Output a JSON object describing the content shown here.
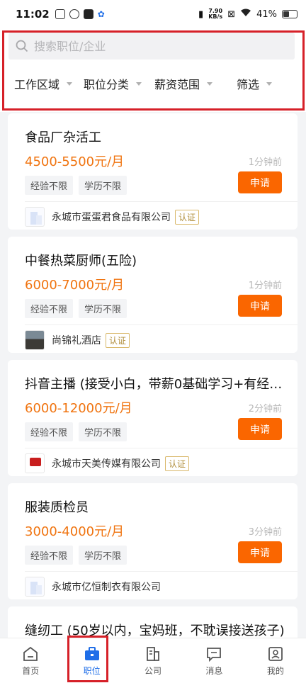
{
  "status_bar": {
    "time": "11:02",
    "net_speed_value": "7.90",
    "net_speed_unit": "KB/s",
    "battery": "41%"
  },
  "search": {
    "placeholder": "搜索职位/企业"
  },
  "filters": [
    {
      "label": "工作区域"
    },
    {
      "label": "职位分类"
    },
    {
      "label": "薪资范围"
    },
    {
      "label": "筛选"
    }
  ],
  "jobs": [
    {
      "title": "食品厂杂活工",
      "salary": "4500-5500元/月",
      "time": "1分钟前",
      "tags": [
        "经验不限",
        "学历不限"
      ],
      "apply": "申请",
      "company": "永城市蛋蛋君食品有限公司",
      "verified": "认证"
    },
    {
      "title": "中餐热菜厨师(五险)",
      "salary": "6000-7000元/月",
      "time": "1分钟前",
      "tags": [
        "经验不限",
        "学历不限"
      ],
      "apply": "申请",
      "company": "尚锦礼酒店",
      "verified": "认证"
    },
    {
      "title": "抖音主播 (接受小白，带薪0基础学习+有经…",
      "salary": "6000-12000元/月",
      "time": "2分钟前",
      "tags": [
        "经验不限",
        "学历不限"
      ],
      "apply": "申请",
      "company": "永城市天美传媒有限公司",
      "verified": "认证"
    },
    {
      "title": "服装质检员",
      "salary": "3000-4000元/月",
      "time": "3分钟前",
      "tags": [
        "经验不限",
        "学历不限"
      ],
      "apply": "申请",
      "company": "永城市亿恒制衣有限公司",
      "verified": ""
    },
    {
      "title": "缝纫工 (50岁以内，宝妈班，不耽误接送孩子)"
    }
  ],
  "tabs": [
    {
      "label": "首页",
      "icon": "home-icon"
    },
    {
      "label": "职位",
      "icon": "briefcase-icon"
    },
    {
      "label": "公司",
      "icon": "building-icon"
    },
    {
      "label": "消息",
      "icon": "message-icon"
    },
    {
      "label": "我的",
      "icon": "profile-icon"
    }
  ],
  "colors": {
    "accent": "#1f6ee8",
    "salary": "#f07410",
    "apply_button": "#fa6600",
    "annotation": "#d62028"
  }
}
